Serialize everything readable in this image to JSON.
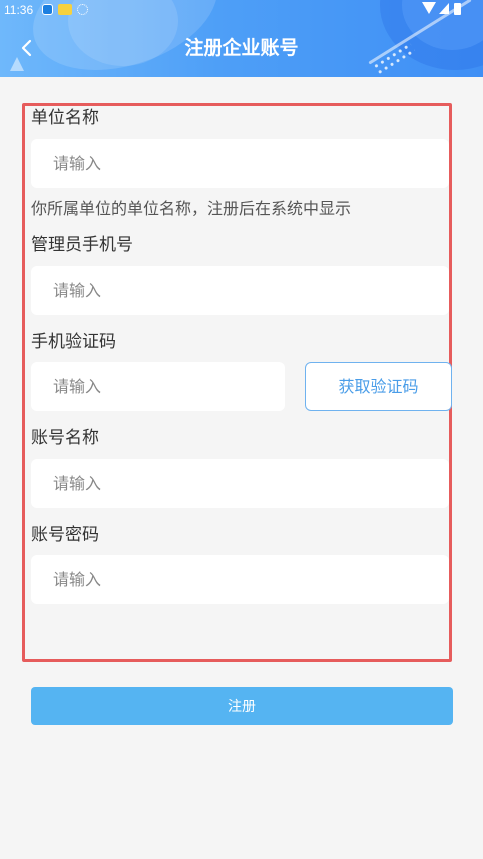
{
  "status_bar": {
    "time": "11:36"
  },
  "header": {
    "title": "注册企业账号"
  },
  "form": {
    "org_name": {
      "label": "单位名称",
      "placeholder": "请输入",
      "hint": "你所属单位的单位名称，注册后在系统中显示"
    },
    "admin_phone": {
      "label": "管理员手机号",
      "placeholder": "请输入"
    },
    "sms_code": {
      "label": "手机验证码",
      "placeholder": "请输入",
      "button": "获取验证码"
    },
    "account_name": {
      "label": "账号名称",
      "placeholder": "请输入"
    },
    "password": {
      "label": "账号密码",
      "placeholder": "请输入"
    }
  },
  "submit": {
    "label": "注册"
  },
  "colors": {
    "header_blue": "#4e9ff7",
    "button_blue": "#55b4f2",
    "highlight_border": "#e65c5c",
    "link_blue": "#4a9de8"
  },
  "icons": [
    "back-arrow-icon",
    "wifi-icon",
    "signal-icon",
    "battery-icon"
  ]
}
